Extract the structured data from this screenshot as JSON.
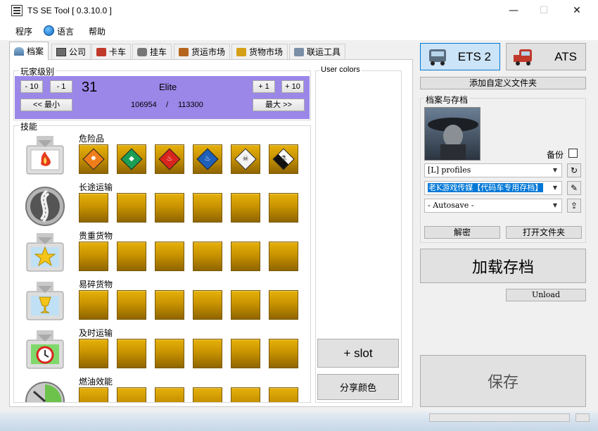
{
  "window": {
    "title": "TS SE Tool [ 0.3.10.0 ]",
    "min": "—",
    "max": "☐",
    "close": "✕"
  },
  "menu": {
    "items": [
      "程序",
      "语言",
      "帮助"
    ]
  },
  "tabs": [
    "档案",
    "公司",
    "卡车",
    "挂车",
    "货运市场",
    "货物市场",
    "联运工具"
  ],
  "player_level": {
    "label": "玩家级别",
    "minus10": "- 10",
    "minus1": "- 1",
    "plus1": "+ 1",
    "plus10": "+ 10",
    "level": "31",
    "rank": "Elite",
    "min_btn": "<< 最小",
    "max_btn": "最大 >>",
    "xp_current": "106954",
    "xp_sep": "/",
    "xp_next": "113300"
  },
  "skills": {
    "label": "技能",
    "rows": [
      {
        "name": "危险品",
        "level": 6,
        "max": 6
      },
      {
        "name": "长途运输",
        "level": 0,
        "max": 6
      },
      {
        "name": "贵重货物",
        "level": 0,
        "max": 6
      },
      {
        "name": "易碎货物",
        "level": 0,
        "max": 6
      },
      {
        "name": "及时运输",
        "level": 0,
        "max": 6
      },
      {
        "name": "燃油效能",
        "level": 0,
        "max": 6
      }
    ]
  },
  "user_colors": {
    "label": "User colors",
    "add_slot": "+ slot",
    "share": "分享颜色"
  },
  "games": {
    "ets": "ETS 2",
    "ats": "ATS"
  },
  "add_folder": "添加自定义文件夹",
  "profiles": {
    "label": "档案与存档",
    "backup_label": "备份",
    "folder": "[L] profiles",
    "profile": "老K游戏传媒【代码车专用存档】",
    "save": "- Autosave -",
    "decrypt": "解密",
    "open_folder": "打开文件夹"
  },
  "load_save": "加载存档",
  "unload": "Unload",
  "save_btn": "保存",
  "colors": {
    "level_panel": "#9a87e8",
    "slot_gold": "#c89300",
    "ets_selected": "#cce4f7"
  }
}
